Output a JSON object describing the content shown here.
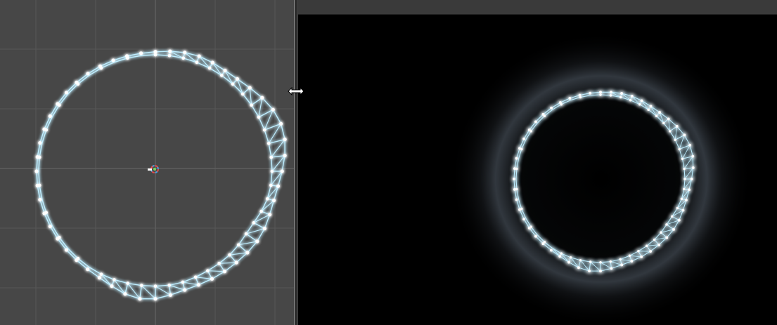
{
  "scene_view": {
    "background_color": "#474747",
    "grid_line_color": "#575757",
    "axis_line_color": "#5f5f5f",
    "pivot_icon": "pivot-gizmo-icon"
  },
  "game_view": {
    "background_color": "#000000",
    "toolbar_color": "#3a3a3a"
  },
  "ring": {
    "glow_color": "#8fd8ff",
    "node_color": "#ffffff",
    "edge_color": "#bfeeff"
  },
  "cursor": {
    "icon": "horizontal-resize-cursor-icon"
  }
}
